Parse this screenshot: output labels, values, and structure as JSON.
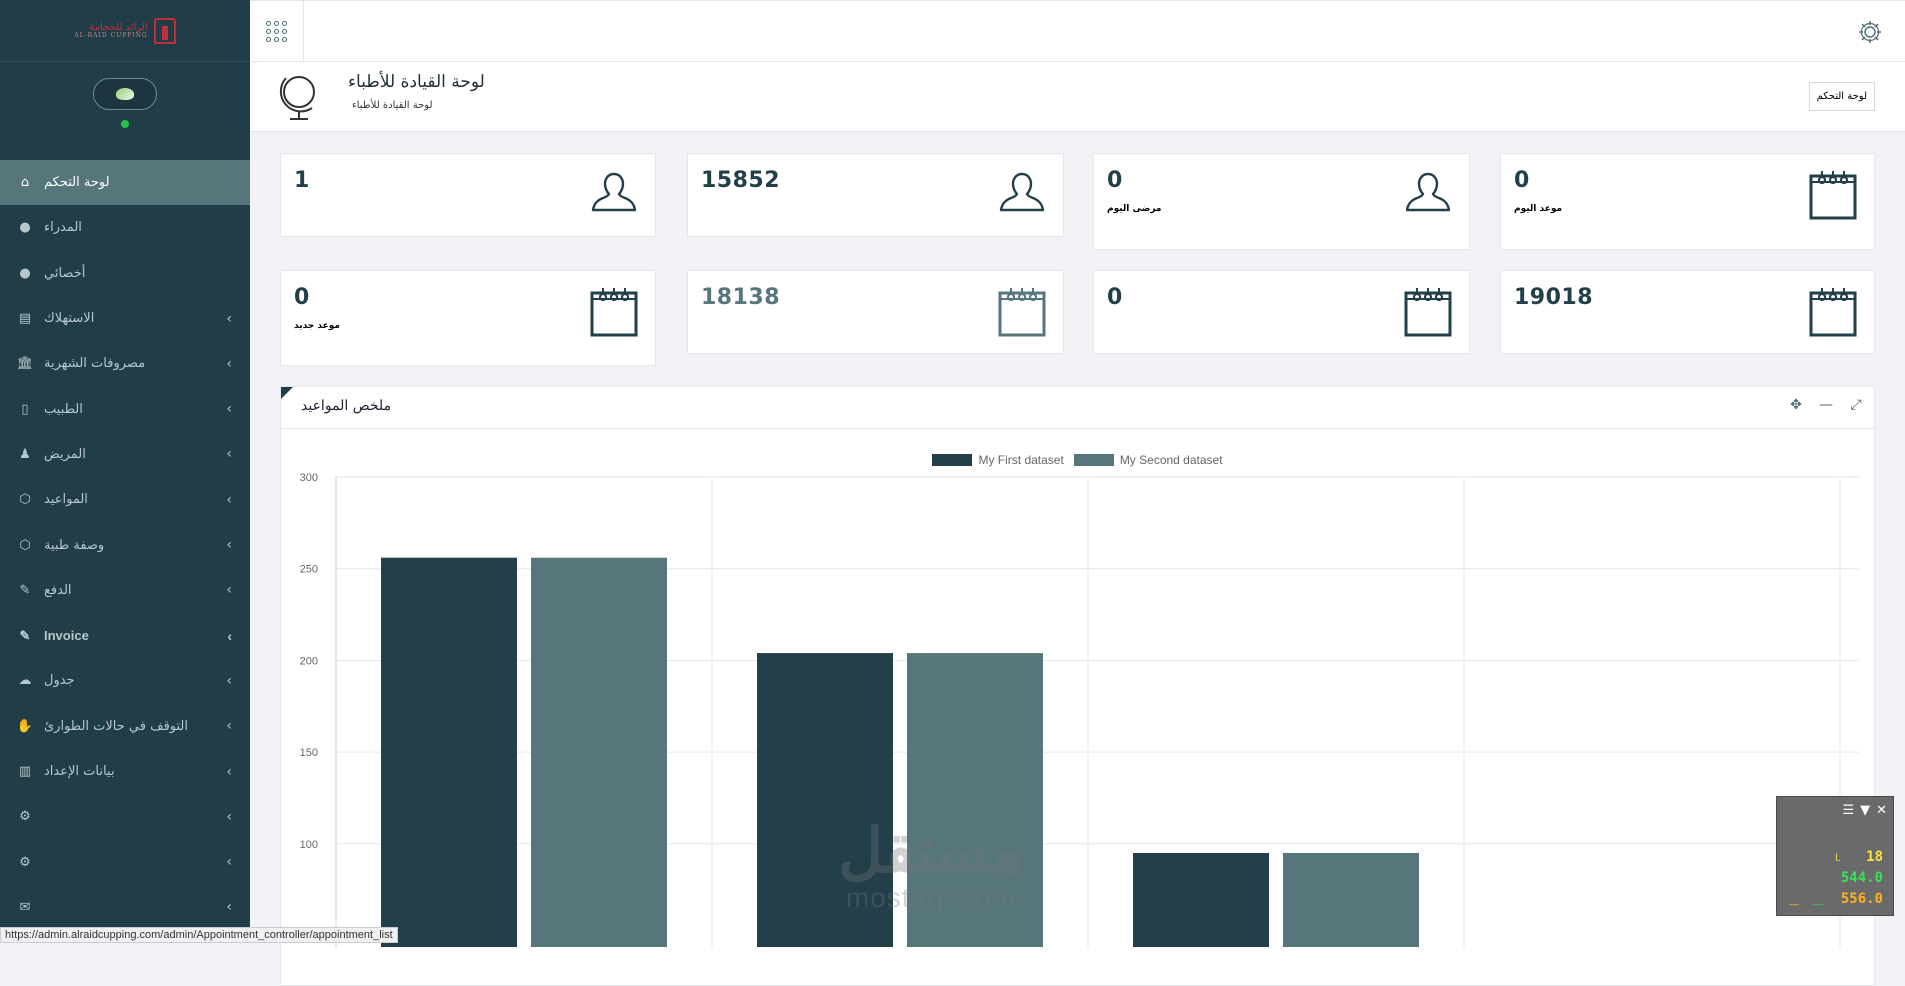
{
  "sidebar": {
    "brand": {
      "name": "الرائد للحجامة",
      "sub": "AL-RAID CUPPING"
    },
    "items": [
      {
        "label": "لوحة التحكم",
        "icon": "home-icon",
        "glyph": "⌂",
        "active": true,
        "chevron": false
      },
      {
        "label": "المدراء",
        "icon": "user-icon",
        "glyph": "●",
        "chevron": false
      },
      {
        "label": "أخصائي",
        "icon": "user-icon",
        "glyph": "●",
        "chevron": false
      },
      {
        "label": "الاستهلاك",
        "icon": "calculator-icon",
        "glyph": "▤",
        "chevron": true
      },
      {
        "label": "مصروفات الشهرية",
        "icon": "bank-icon",
        "glyph": "🏛",
        "chevron": true
      },
      {
        "label": "الطبيب",
        "icon": "document-icon",
        "glyph": "▯",
        "chevron": true
      },
      {
        "label": "المريض",
        "icon": "person-icon",
        "glyph": "♟",
        "chevron": true
      },
      {
        "label": "المواعيد",
        "icon": "cube-icon",
        "glyph": "⬡",
        "chevron": true
      },
      {
        "label": "وصفة طبية",
        "icon": "cube-icon",
        "glyph": "⬡",
        "chevron": true
      },
      {
        "label": "الدفع",
        "icon": "paint-icon",
        "glyph": "✎",
        "chevron": true
      },
      {
        "label": "Invoice",
        "icon": "paint-icon",
        "glyph": "✎",
        "chevron": true
      },
      {
        "label": "جدول",
        "icon": "chat-icon",
        "glyph": "☁",
        "chevron": true
      },
      {
        "label": "التوقف في حالات الطوارئ",
        "icon": "hand-icon",
        "glyph": "✋",
        "chevron": true
      },
      {
        "label": "بيانات الإعداد",
        "icon": "bar-chart-icon",
        "glyph": "▥",
        "chevron": true
      },
      {
        "label": "",
        "icon": "gears-icon",
        "glyph": "⚙",
        "chevron": true
      },
      {
        "label": "",
        "icon": "gears-icon",
        "glyph": "⚙",
        "chevron": true
      },
      {
        "label": "",
        "icon": "envelope-icon",
        "glyph": "✉",
        "chevron": true
      }
    ]
  },
  "header": {
    "title": "لوحة القيادة للأطباء",
    "subtitle": "لوحة القيادة للأطباء",
    "breadcrumb_button": "لوحة التحكم"
  },
  "stats": [
    {
      "value": "1",
      "label": "",
      "icon": "user-outline-icon",
      "muted": false
    },
    {
      "value": "15852",
      "label": "",
      "icon": "user-outline-icon",
      "muted": false
    },
    {
      "value": "0",
      "label": "مرضى اليوم",
      "icon": "user-outline-icon",
      "muted": false
    },
    {
      "value": "0",
      "label": "موعد اليوم",
      "icon": "calendar-icon",
      "muted": false
    },
    {
      "value": "0",
      "label": "موعد جديد",
      "icon": "calendar-icon",
      "muted": false
    },
    {
      "value": "18138",
      "label": "",
      "icon": "calendar-icon",
      "muted": true
    },
    {
      "value": "0",
      "label": "",
      "icon": "calendar-icon",
      "muted": false
    },
    {
      "value": "19018",
      "label": "",
      "icon": "calendar-icon",
      "muted": false
    }
  ],
  "panel": {
    "title": "ملخص المواعيد",
    "tools": [
      "move-icon",
      "minimize-icon",
      "expand-icon"
    ]
  },
  "chart_data": {
    "type": "bar",
    "categories": [
      "",
      "",
      "",
      ""
    ],
    "series": [
      {
        "name": "My First dataset",
        "color": "#223f4a",
        "values": [
          256,
          204,
          95,
          null
        ]
      },
      {
        "name": "My Second dataset",
        "color": "#56767c",
        "values": [
          256,
          204,
          95,
          null
        ]
      }
    ],
    "yticks": [
      "300",
      "250",
      "200",
      "150",
      "100"
    ],
    "ylim": [
      100,
      300
    ],
    "grid": true,
    "legend_position": "top"
  },
  "status_url": "https://admin.alraidcupping.com/admin/Appointment_controller/appointment_list",
  "watermark": {
    "arabic": "مستقل",
    "latin": "mostaql.com"
  },
  "widget": {
    "row1": "18",
    "row2": "544.0",
    "row3": "556.0",
    "colors": {
      "row1": "#ffe23a",
      "row2": "#39e05a",
      "row3": "#ffb020"
    }
  },
  "colors": {
    "sidebar": "#213d47",
    "active": "#56767c",
    "primary": "#223f4a"
  }
}
